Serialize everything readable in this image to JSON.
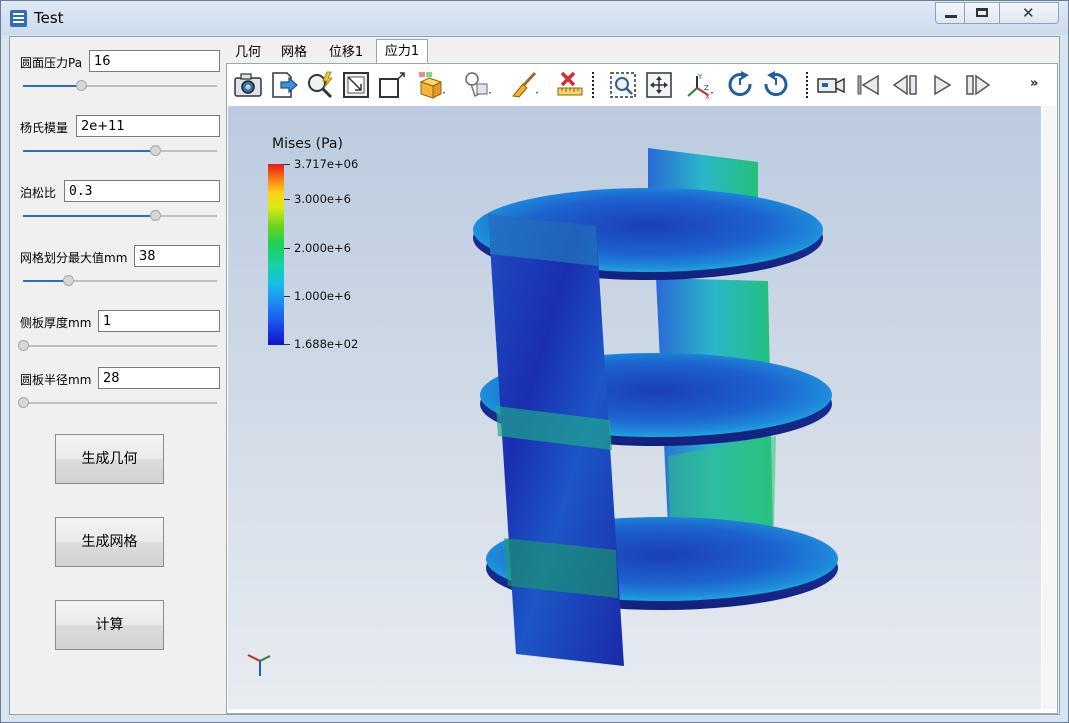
{
  "window": {
    "title": "Test",
    "close_glyph": "✕"
  },
  "params": [
    {
      "label": "圆面压力Pa",
      "value": "16",
      "slider": 0.3
    },
    {
      "label": "杨氏模量",
      "value": "2e+11",
      "slider": 0.68
    },
    {
      "label": "泊松比",
      "value": "0.3",
      "slider": 0.68
    },
    {
      "label": "网格划分最大值mm",
      "value": "38",
      "slider": 0.23
    },
    {
      "label": "侧板厚度mm",
      "value": "1",
      "slider": 0.0
    },
    {
      "label": "圆板半径mm",
      "value": "28",
      "slider": 0.0
    }
  ],
  "buttons": {
    "geometry": "生成几何",
    "mesh": "生成网格",
    "compute": "计算"
  },
  "tabs": [
    "几何",
    "网格",
    "位移1",
    "应力1"
  ],
  "active_tab": "应力1",
  "toolbar": {
    "icons": [
      "camera-icon",
      "export-icon",
      "zoom-search-icon",
      "frame-icon",
      "cube-outline-icon",
      "box-select-icon",
      "display-icon",
      "brush-icon",
      "delete-ruler-icon",
      "zoom-region-icon",
      "pan-icon",
      "axes-icon",
      "rotate-cw-icon",
      "rotate-ccw-icon",
      "video-icon",
      "first-frame-icon",
      "prev-frame-icon",
      "play-icon",
      "next-frame-icon"
    ],
    "overflow": "»"
  },
  "legend": {
    "title": "Mises (Pa)",
    "ticks": [
      "3.717e+06",
      "3.000e+6",
      "2.000e+6",
      "1.000e+6",
      "1.688e+02"
    ]
  },
  "colors": {
    "accent": "#2f6db8",
    "model_blue": "#1a34b8"
  }
}
